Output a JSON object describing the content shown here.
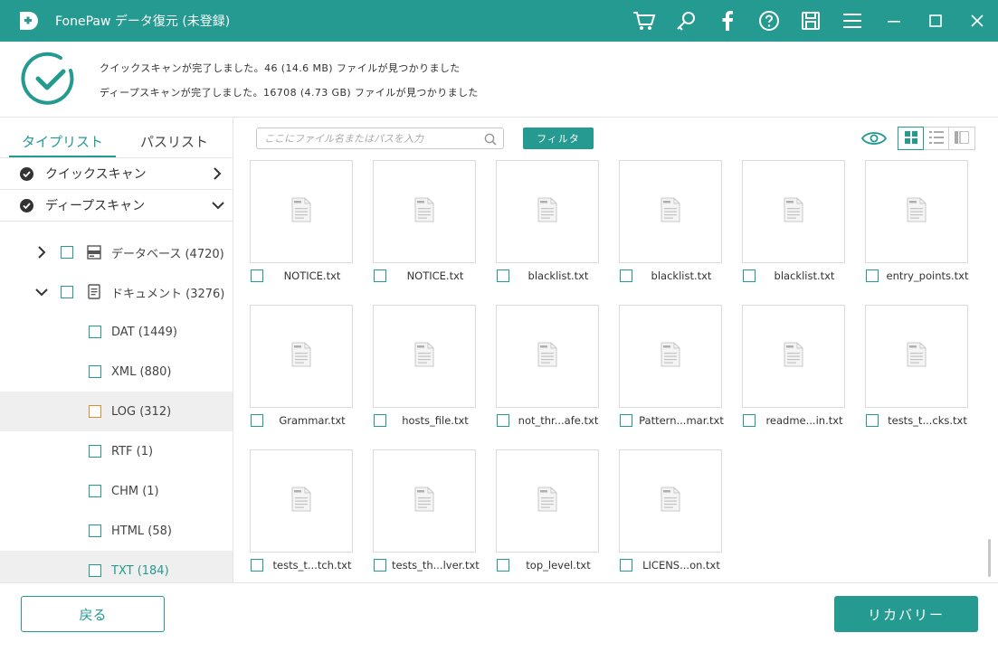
{
  "app": {
    "title": "FonePaw データ復元 (未登録)"
  },
  "titlebar_icons": [
    "cart-icon",
    "key-icon",
    "facebook-icon",
    "help-icon",
    "save-icon",
    "menu-icon",
    "minimize-icon",
    "maximize-icon",
    "close-icon"
  ],
  "status": {
    "line1": "クイックスキャンが完了しました。46 (14.6 MB) ファイルが見つかりました",
    "line2": "ディープスキャンが完了しました。16708 (4.73 GB) ファイルが見つかりました"
  },
  "sidebar": {
    "tabs": [
      {
        "label": "タイプリスト"
      },
      {
        "label": "パスリスト"
      }
    ],
    "scans": [
      {
        "label": "クイックスキャン"
      },
      {
        "label": "ディープスキャン"
      }
    ],
    "tree": [
      {
        "label": "データベース (4720)"
      },
      {
        "label": "ドキュメント (3276)"
      },
      {
        "label": "DAT (1449)"
      },
      {
        "label": "XML (880)"
      },
      {
        "label": "LOG (312)"
      },
      {
        "label": "RTF (1)"
      },
      {
        "label": "CHM (1)"
      },
      {
        "label": "HTML (58)"
      },
      {
        "label": "TXT (184)"
      }
    ]
  },
  "toolbar": {
    "search_placeholder": "ここにファイル名またはパスを入力",
    "filter_label": "フィルタ"
  },
  "files": [
    {
      "name": "NOTICE.txt"
    },
    {
      "name": "NOTICE.txt"
    },
    {
      "name": "blacklist.txt"
    },
    {
      "name": "blacklist.txt"
    },
    {
      "name": "blacklist.txt"
    },
    {
      "name": "entry_points.txt"
    },
    {
      "name": "Grammar.txt"
    },
    {
      "name": "hosts_file.txt"
    },
    {
      "name": "not_thr...afe.txt"
    },
    {
      "name": "Pattern...mar.txt"
    },
    {
      "name": "readme...in.txt"
    },
    {
      "name": "tests_t...cks.txt"
    },
    {
      "name": "tests_t...tch.txt"
    },
    {
      "name": "tests_th...lver.txt"
    },
    {
      "name": "top_level.txt"
    },
    {
      "name": "LICENS...on.txt"
    }
  ],
  "footer": {
    "back_label": "戻る",
    "recover_label": "リカバリー"
  },
  "colors": {
    "accent": "#249a91",
    "selected_bg": "#efefef",
    "log_checkbox": "#e08b2a"
  }
}
